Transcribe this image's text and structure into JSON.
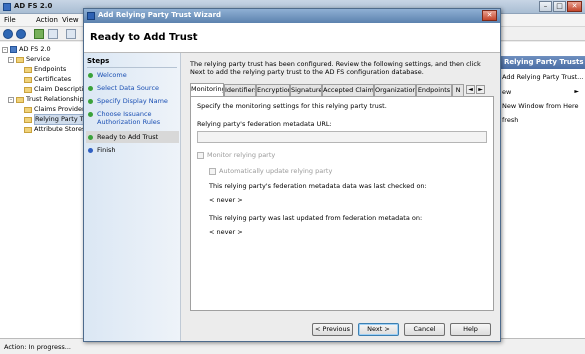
{
  "mmc": {
    "title": "AD FS 2.0",
    "menu": [
      "File",
      "Action",
      "View"
    ],
    "tree": {
      "root": "AD FS 2.0",
      "service": "Service",
      "endpoints": "Endpoints",
      "certificates": "Certificates",
      "claim_descriptions": "Claim Description",
      "trust_relationships": "Trust Relationships",
      "claims_provider": "Claims Provider",
      "relying_party": "Relying Party Tr",
      "attribute_stores": "Attribute Stores"
    },
    "actions": {
      "header": "Relying Party Trusts",
      "items": [
        "Add Relying Party Trust...",
        "ew",
        "New Window from Here",
        "fresh"
      ]
    },
    "status": "Action: In progress..."
  },
  "wizard": {
    "title": "Add Relying Party Trust Wizard",
    "close_glyph": "✕",
    "heading": "Ready to Add Trust",
    "steps_header": "Steps",
    "steps": [
      {
        "label": "Welcome",
        "state": "done"
      },
      {
        "label": "Select Data Source",
        "state": "done"
      },
      {
        "label": "Specify Display Name",
        "state": "done"
      },
      {
        "label": "Choose Issuance Authorization Rules",
        "state": "done"
      },
      {
        "label": "Ready to Add Trust",
        "state": "current"
      },
      {
        "label": "Finish",
        "state": "pending"
      }
    ],
    "step4_line1": "Choose Issuance",
    "step4_line2": "Authorization Rules",
    "description": "The relying party trust has been configured. Review the following settings, and then click Next to add the relying party trust to the AD FS configuration database.",
    "tabs": [
      "Monitoring",
      "Identifiers",
      "Encryption",
      "Signature",
      "Accepted Claims",
      "Organization",
      "Endpoints",
      "N"
    ],
    "active_tab": "Monitoring",
    "tab_scroll_left": "◄",
    "tab_scroll_right": "►",
    "monitoring": {
      "intro": "Specify the monitoring settings for this relying party trust.",
      "metadata_url_label": "Relying party's federation metadata URL:",
      "metadata_url_value": "",
      "monitor_checkbox": "Monitor relying party",
      "auto_update_checkbox": "Automatically update relying party",
      "last_checked_label": "This relying party's federation metadata data was last checked on:",
      "last_checked_value": "< never >",
      "last_updated_label": "This relying party was last updated from federation metadata on:",
      "last_updated_value": "< never >"
    },
    "buttons": {
      "previous": "< Previous",
      "next": "Next >",
      "cancel": "Cancel",
      "help": "Help"
    }
  }
}
